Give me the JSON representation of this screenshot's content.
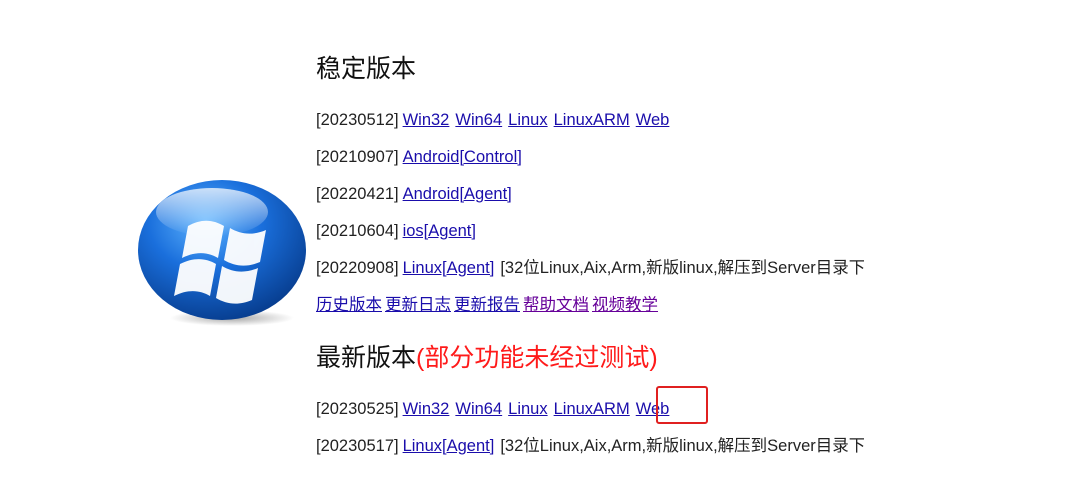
{
  "stable": {
    "title": "稳定版本",
    "rows": [
      {
        "date": "[20230512]",
        "links": [
          "Win32",
          "Win64",
          "Linux",
          "LinuxARM",
          "Web"
        ],
        "note": ""
      },
      {
        "date": "[20210907]",
        "links": [
          "Android[Control]"
        ],
        "note": ""
      },
      {
        "date": "[20220421]",
        "links": [
          "Android[Agent]"
        ],
        "note": ""
      },
      {
        "date": "[20210604]",
        "links": [
          "ios[Agent]"
        ],
        "note": ""
      },
      {
        "date": "[20220908]",
        "links": [
          "Linux[Agent]"
        ],
        "note": "[32位Linux,Aix,Arm,新版linux,解压到Server目录下]"
      }
    ],
    "footer_links": [
      "历史版本",
      "更新日志",
      "更新报告",
      "帮助文档",
      "视频教学"
    ]
  },
  "latest": {
    "title": "最新版本",
    "title_warning": "(部分功能未经过测试)",
    "rows": [
      {
        "date": "[20230525]",
        "links": [
          "Win32",
          "Win64",
          "Linux",
          "LinuxARM",
          "Web"
        ],
        "note": ""
      },
      {
        "date": "[20230517]",
        "links": [
          "Linux[Agent]"
        ],
        "note": "[32位Linux,Aix,Arm,新版linux,解压到Server目录下]"
      }
    ]
  },
  "logo_icon": "windows-orb-icon",
  "colors": {
    "link": "#1a0dab",
    "visited_link": "#660099",
    "warning": "#ff1a1a",
    "highlight_box": "#e02020"
  }
}
